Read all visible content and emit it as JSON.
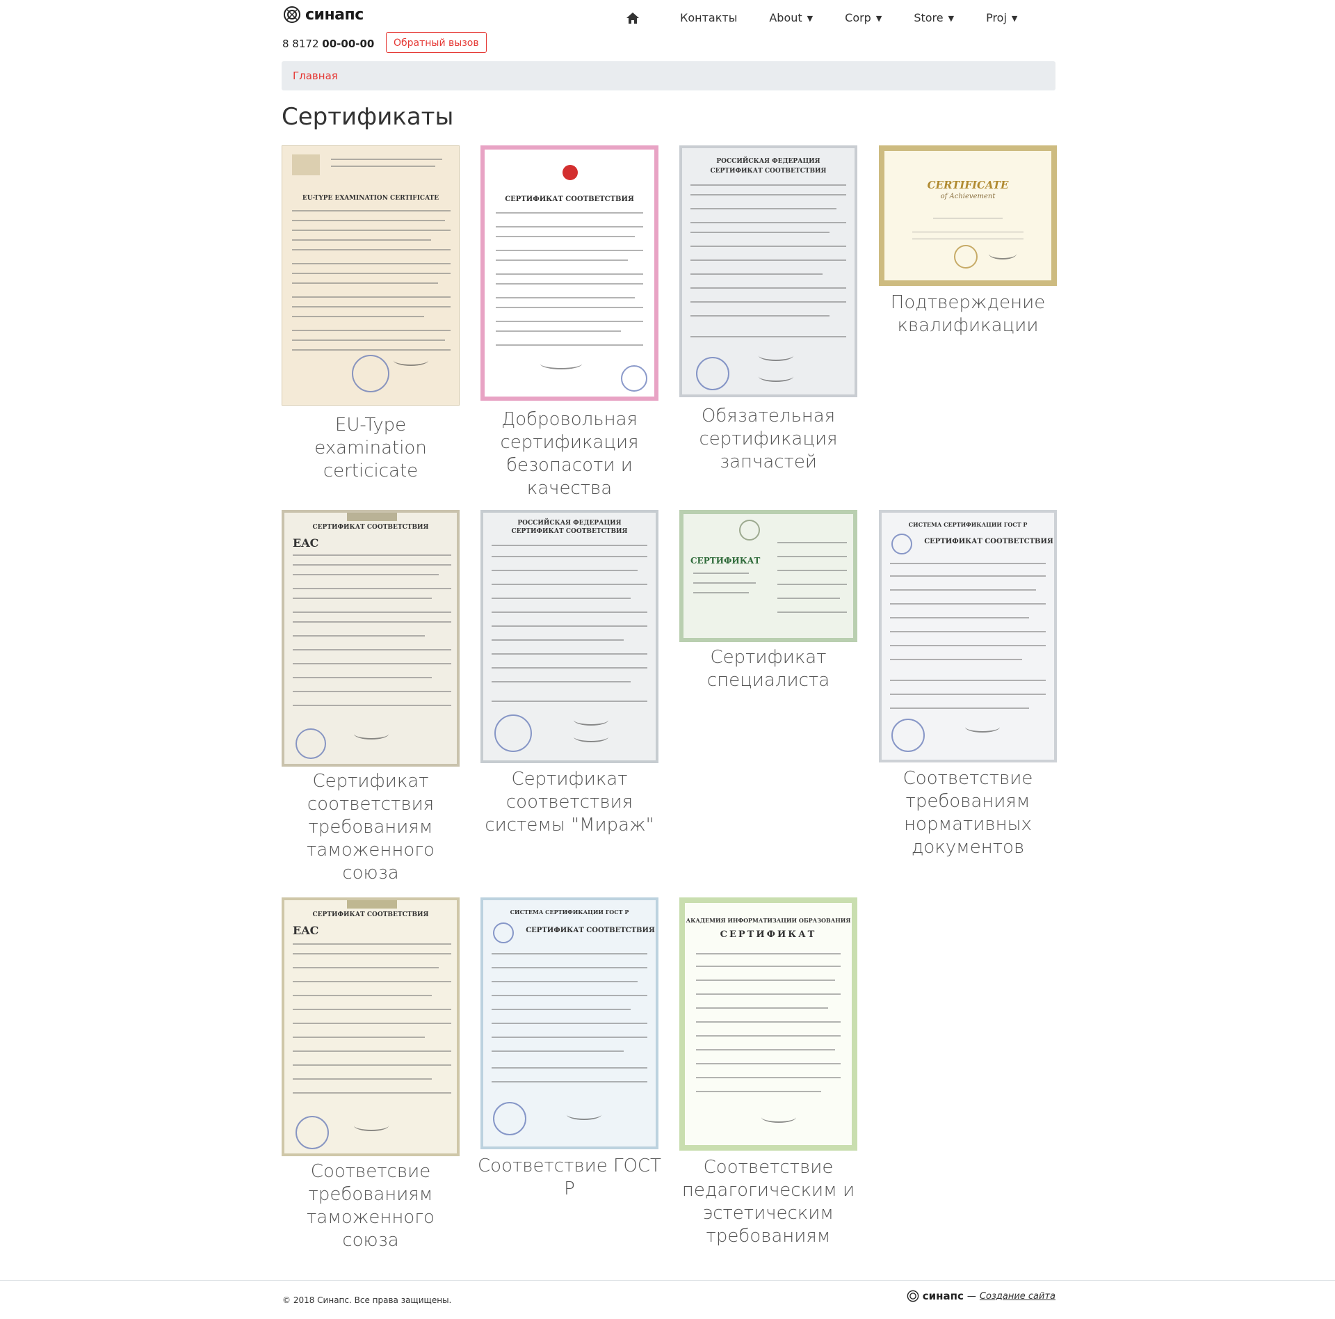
{
  "header": {
    "logo_text": "синапс",
    "phone_prefix": "8 8172",
    "phone_number": "00-00-00",
    "callback_label": "Обратный вызов",
    "nav": [
      {
        "label": "Контакты",
        "has_dropdown": false
      },
      {
        "label": "About",
        "has_dropdown": true
      },
      {
        "label": "Corp",
        "has_dropdown": true
      },
      {
        "label": "Store",
        "has_dropdown": true
      },
      {
        "label": "Proj",
        "has_dropdown": true
      }
    ]
  },
  "breadcrumb": {
    "home": "Главная"
  },
  "page_title": "Сертификаты",
  "certificates": [
    {
      "caption": "EU-Type examination certicicate",
      "doc_title": "EU-TYPE EXAMINATION CERTIFICATE",
      "style": "beige"
    },
    {
      "caption": "Добровольная сертификация безопасоти и качества",
      "doc_title": "СЕРТИФИКАТ СООТВЕТСТВИЯ",
      "style": "pink"
    },
    {
      "caption": "Обязательная сертификация запчастей",
      "doc_title": "СЕРТИФИКАТ СООТВЕТСТВИЯ",
      "style": "gray"
    },
    {
      "caption": "Подтверждение квалификации",
      "doc_title": "CERTIFICATE",
      "style": "gold"
    },
    {
      "caption": "Сертификат соответствия требованиям таможенного союза",
      "doc_title": "СЕРТИФИКАТ СООТВЕТСТВИЯ",
      "style": "eac"
    },
    {
      "caption": "Сертификат соответствия системы \"Мираж\"",
      "doc_title": "СЕРТИФИКАТ СООТВЕТСТВИЯ",
      "style": "gray2"
    },
    {
      "caption": "Сертификат специалиста",
      "doc_title": "СЕРТИФИКАТ",
      "style": "green"
    },
    {
      "caption": "Соответствие требованиям нормативных документов",
      "doc_title": "СЕРТИФИКАТ СООТВЕТСТВИЯ",
      "style": "gost"
    },
    {
      "caption": "Соответсвие требованиям таможенного союза",
      "doc_title": "СЕРТИФИКАТ СООТВЕТСТВИЯ",
      "style": "eac"
    },
    {
      "caption": "Соответствие ГОСТ Р",
      "doc_title": "СЕРТИФИКАТ СООТВЕТСТВИЯ",
      "style": "gostblue"
    },
    {
      "caption": "Соответствие педагогическим и эстетическим требованиям",
      "doc_title": "СЕРТИФИКАТ",
      "style": "greenframe"
    }
  ],
  "footer": {
    "copyright": "© 2018 Синапс. Все права защищены.",
    "brand": "синапс",
    "dash": "—",
    "link": "Создание сайта"
  },
  "colors": {
    "accent": "#e53935",
    "breadcrumb_bg": "#e9ecef"
  }
}
